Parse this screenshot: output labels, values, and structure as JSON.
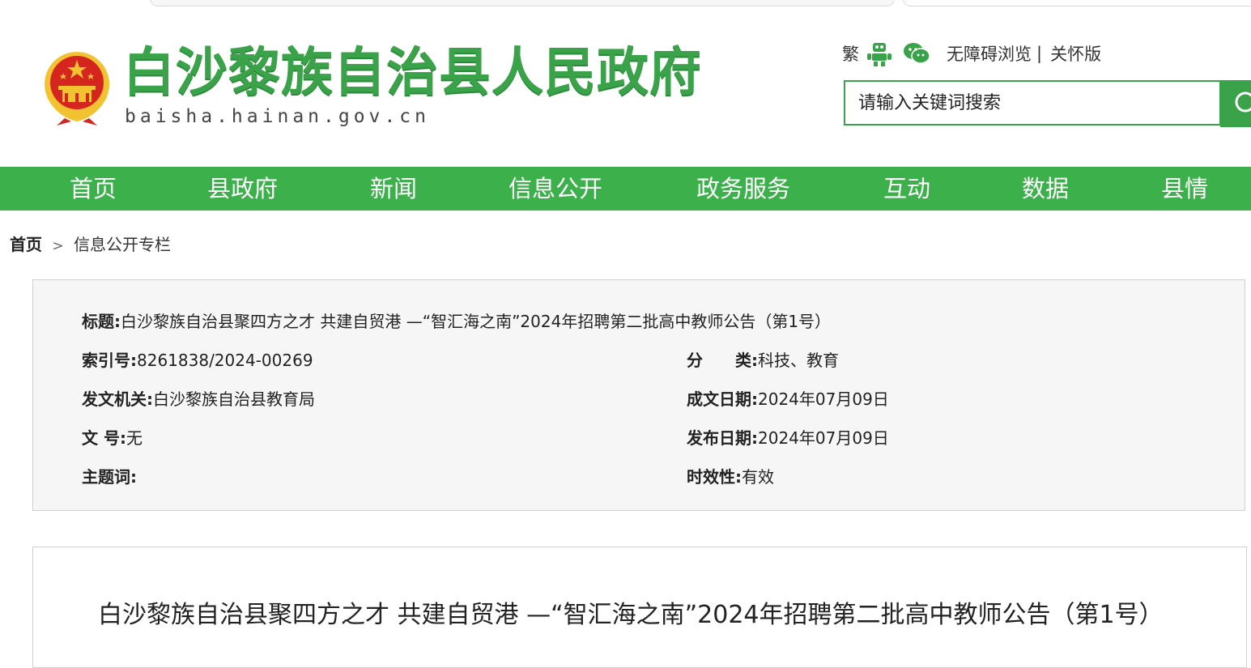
{
  "header": {
    "site_title": "白沙黎族自治县人民政府",
    "site_domain": "baisha.hainan.gov.cn",
    "traditional_label": "繁",
    "accessibility_label": "无障碍浏览",
    "separator": "|",
    "elder_mode_label": "关怀版",
    "search_placeholder": "请输入关键词搜索"
  },
  "nav": {
    "items": [
      {
        "label": "首页"
      },
      {
        "label": "县政府"
      },
      {
        "label": "新闻"
      },
      {
        "label": "信息公开"
      },
      {
        "label": "政务服务"
      },
      {
        "label": "互动"
      },
      {
        "label": "数据"
      },
      {
        "label": "县情"
      }
    ]
  },
  "breadcrumb": {
    "home": "首页",
    "arrow": ">",
    "current": "信息公开专栏"
  },
  "meta": {
    "title_key": "标题:",
    "title_value": "白沙黎族自治县聚四方之才 共建自贸港 —“智汇海之南”2024年招聘第二批高中教师公告（第1号）",
    "index_key": "索引号:",
    "index_value": "8261838/2024-00269",
    "category_key": "分　　类:",
    "category_value": "科技、教育",
    "issuer_key": "发文机关:",
    "issuer_value": "白沙黎族自治县教育局",
    "created_key": "成文日期:",
    "created_value": "2024年07月09日",
    "docno_key": "文  号:",
    "docno_value": "无",
    "published_key": "发布日期:",
    "published_value": "2024年07月09日",
    "keywords_key": "主题词:",
    "keywords_value": "",
    "validity_key": "时效性:",
    "validity_value": "有效"
  },
  "article": {
    "title": "白沙黎族自治县聚四方之才 共建自贸港 —“智汇海之南”2024年招聘第二批高中教师公告（第1号）"
  },
  "colors": {
    "brand_green": "#3cb04a",
    "title_green": "#3aa34a",
    "emblem_red": "#d4261f",
    "emblem_gold": "#f2c230"
  },
  "icons": [
    "national-emblem-icon",
    "robot-accessibility-icon",
    "wechat-icon",
    "search-icon"
  ]
}
